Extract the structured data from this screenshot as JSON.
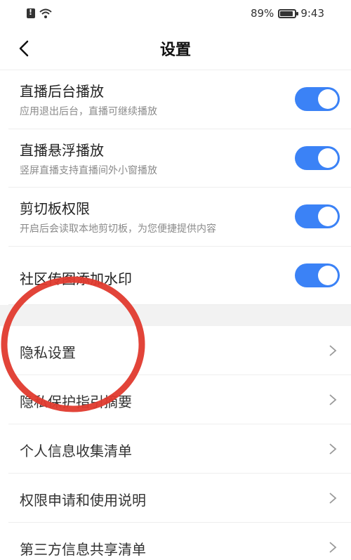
{
  "status_bar": {
    "battery_percent": "89%",
    "time": "9:43",
    "icons": [
      "sim-alert-icon",
      "wifi-icon",
      "battery-icon"
    ]
  },
  "header": {
    "title": "设置",
    "back_icon": "chevron-left-icon"
  },
  "toggles": [
    {
      "title": "直播后台播放",
      "subtitle": "应用退出后台，直播可继续播放",
      "on": true
    },
    {
      "title": "直播悬浮播放",
      "subtitle": "竖屏直播支持直播间外小窗播放",
      "on": true
    },
    {
      "title": "剪切板权限",
      "subtitle": "开启后会读取本地剪切板，为您便捷提供内容",
      "on": true
    },
    {
      "title": "社区传图添加水印",
      "on": true
    }
  ],
  "links": [
    {
      "label": "隐私设置"
    },
    {
      "label": "隐私保护指引摘要"
    },
    {
      "label": "个人信息收集清单"
    },
    {
      "label": "权限申请和使用说明"
    },
    {
      "label": "第三方信息共享清单"
    }
  ],
  "colors": {
    "toggle_on": "#3b82f6",
    "annotation": "#e03a2e"
  }
}
